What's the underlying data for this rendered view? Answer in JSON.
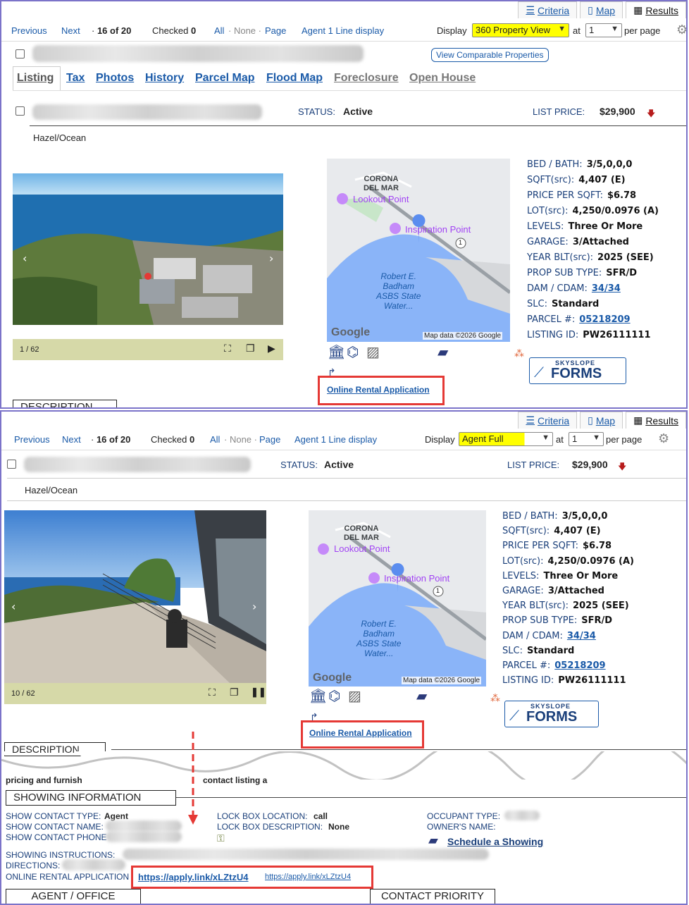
{
  "top_tabs": {
    "criteria": "Criteria",
    "map": "Map",
    "results": "Results"
  },
  "nav": {
    "previous": "Previous",
    "next": "Next",
    "position": "16 of 20",
    "checked_label": "Checked",
    "checked_count": "0",
    "all": "All",
    "none": "None",
    "page": "Page",
    "agent_display": "Agent 1 Line display",
    "display_label": "Display",
    "at_label": "at",
    "per_page_label": "per page",
    "per_page_value": "1"
  },
  "view1": {
    "display_value": "360 Property View"
  },
  "view2": {
    "display_value": "Agent Full"
  },
  "comparable_button": "View Comparable Properties",
  "listing_tabs": [
    "Listing",
    "Tax",
    "Photos",
    "History",
    "Parcel Map",
    "Flood Map",
    "Foreclosure",
    "Open House"
  ],
  "status_label": "STATUS:",
  "status_value": "Active",
  "list_price_label": "LIST PRICE:",
  "list_price_value": "$29,900",
  "cross_streets": "Hazel/Ocean",
  "photo1_counter": "1 / 62",
  "photo2_counter": "10 / 62",
  "map": {
    "area": "CORONA\nDEL MAR",
    "poi1": "Lookout Point",
    "poi2": "Inspiration Point",
    "park": "Robert E.\nBadham\nASBS State\nWater...",
    "route": "1",
    "google": "Google",
    "attribution": "Map data ©2026 Google"
  },
  "facts": [
    {
      "label": "BED / BATH:",
      "value": "3/5,0,0,0"
    },
    {
      "label": "SQFT(src):",
      "value": "4,407 (E)"
    },
    {
      "label": "PRICE PER SQFT:",
      "value": "$6.78"
    },
    {
      "label": "LOT(src):",
      "value": "4,250/0.0976 (A)"
    },
    {
      "label": "LEVELS:",
      "value": "Three Or More"
    },
    {
      "label": "GARAGE:",
      "value": "3/Attached"
    },
    {
      "label": "YEAR BLT(src):",
      "value": "2025 (SEE)"
    },
    {
      "label": "PROP SUB TYPE:",
      "value": "SFR/D"
    },
    {
      "label": "DAM / CDAM:",
      "value": "34/34"
    },
    {
      "label": "SLC:",
      "value": "Standard"
    },
    {
      "label": "PARCEL #:",
      "value": "05218209"
    },
    {
      "label": "LISTING ID:",
      "value": "PW26111111"
    }
  ],
  "rental_app_link": "Online Rental Application",
  "skyslope": {
    "top": "SKYSLOPE",
    "bottom": "FORMS"
  },
  "description_label": "DESCRIPTION",
  "desc_fragment_left": "pricing and furnish",
  "desc_fragment_right": "contact listing a",
  "showing": {
    "title": "SHOWING INFORMATION",
    "contact_type_label": "SHOW CONTACT TYPE:",
    "contact_type_value": "Agent",
    "contact_name_label": "SHOW CONTACT NAME:",
    "contact_phone_label": "SHOW CONTACT PHONE",
    "lockbox_location_label": "LOCK BOX LOCATION:",
    "lockbox_location_value": "call",
    "lockbox_desc_label": "LOCK BOX DESCRIPTION:",
    "lockbox_desc_value": "None",
    "occupant_label": "OCCUPANT TYPE:",
    "owner_label": "OWNER'S NAME:",
    "schedule_link": "Schedule a Showing",
    "instructions_label": "SHOWING INSTRUCTIONS:",
    "directions_label": "DIRECTIONS:",
    "rental_label": "ONLINE RENTAL APPLICATION",
    "rental_url": "https://apply.link/xLZtzU4",
    "rental_url_small": "https://apply.link/xLZtzU4"
  },
  "agent_office_label": "AGENT / OFFICE",
  "contact_priority_label": "CONTACT PRIORITY",
  "colors": {
    "accent_link": "#1a5aa8",
    "highlight": "#ffff00",
    "callout": "#e53935",
    "frame": "#7b73c9"
  }
}
